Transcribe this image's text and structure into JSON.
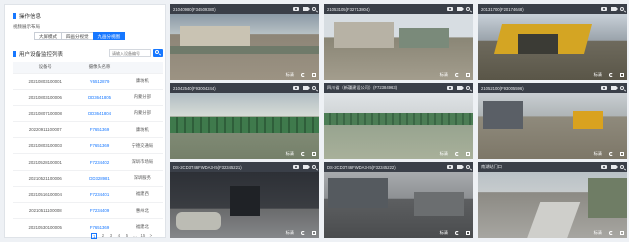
{
  "left": {
    "section_title": "操作信息",
    "layout_caption": "视频展示布局",
    "layout_buttons": [
      {
        "label": "大屏模式",
        "active": false
      },
      {
        "label": "四画分视觉",
        "active": false
      },
      {
        "label": "九画分视图",
        "active": true
      }
    ],
    "device_list_title": "用户设备监控列表",
    "search_placeholder": "请输入设备编号",
    "table": {
      "headers": [
        "设备号",
        "摄像头名称",
        ""
      ],
      "rows": [
        [
          "20210803100001",
          "Y6512879",
          "康坊机"
        ],
        [
          "20210803100006",
          "DD3641805",
          "内蒙分部"
        ],
        [
          "20210807100008",
          "DD3641804",
          "内蒙分部"
        ],
        [
          "20220911100007",
          "F7651369",
          "康坊机"
        ],
        [
          "20210803100003",
          "F7651369",
          "宁德交通局"
        ],
        [
          "20210528100001",
          "F7234402",
          "深圳市场局"
        ],
        [
          "20210521100006",
          "DD328981",
          "深圳服务"
        ],
        [
          "20210516100004",
          "F7234401",
          "福建西"
        ],
        [
          "20210511100008",
          "F7234409",
          "惠州北"
        ],
        [
          "20210530100005",
          "F7651369",
          "福建北"
        ]
      ]
    },
    "pagination": [
      "1",
      "2",
      "3",
      "4",
      "5",
      "…",
      "15",
      ">"
    ],
    "active_page": "1"
  },
  "tiles": [
    {
      "title": "21040980(F34509380)",
      "quality": "标清",
      "scene": "site"
    },
    {
      "title": "21053105(F32713804)",
      "quality": "标清",
      "scene": "building"
    },
    {
      "title": "20131700(F20174648)",
      "quality": "标清",
      "scene": "crane"
    },
    {
      "title": "21042540(F93004244)",
      "quality": "标清",
      "scene": "fence"
    },
    {
      "title": "四川省（新疆建设公司）(F72384963)",
      "quality": "标清",
      "scene": "field"
    },
    {
      "title": "21052100(F93005596)",
      "quality": "标清",
      "scene": "excavator"
    },
    {
      "title": "DS-2CD3T46FWDA3-I5(F32345221)",
      "quality": "标清",
      "scene": "warehouse"
    },
    {
      "title": "DS-2CD3T46FWDA3-I5(F32345222)",
      "quality": "标清",
      "scene": "shed"
    },
    {
      "title": "南湖站门口",
      "quality": "标清",
      "scene": "road"
    }
  ]
}
